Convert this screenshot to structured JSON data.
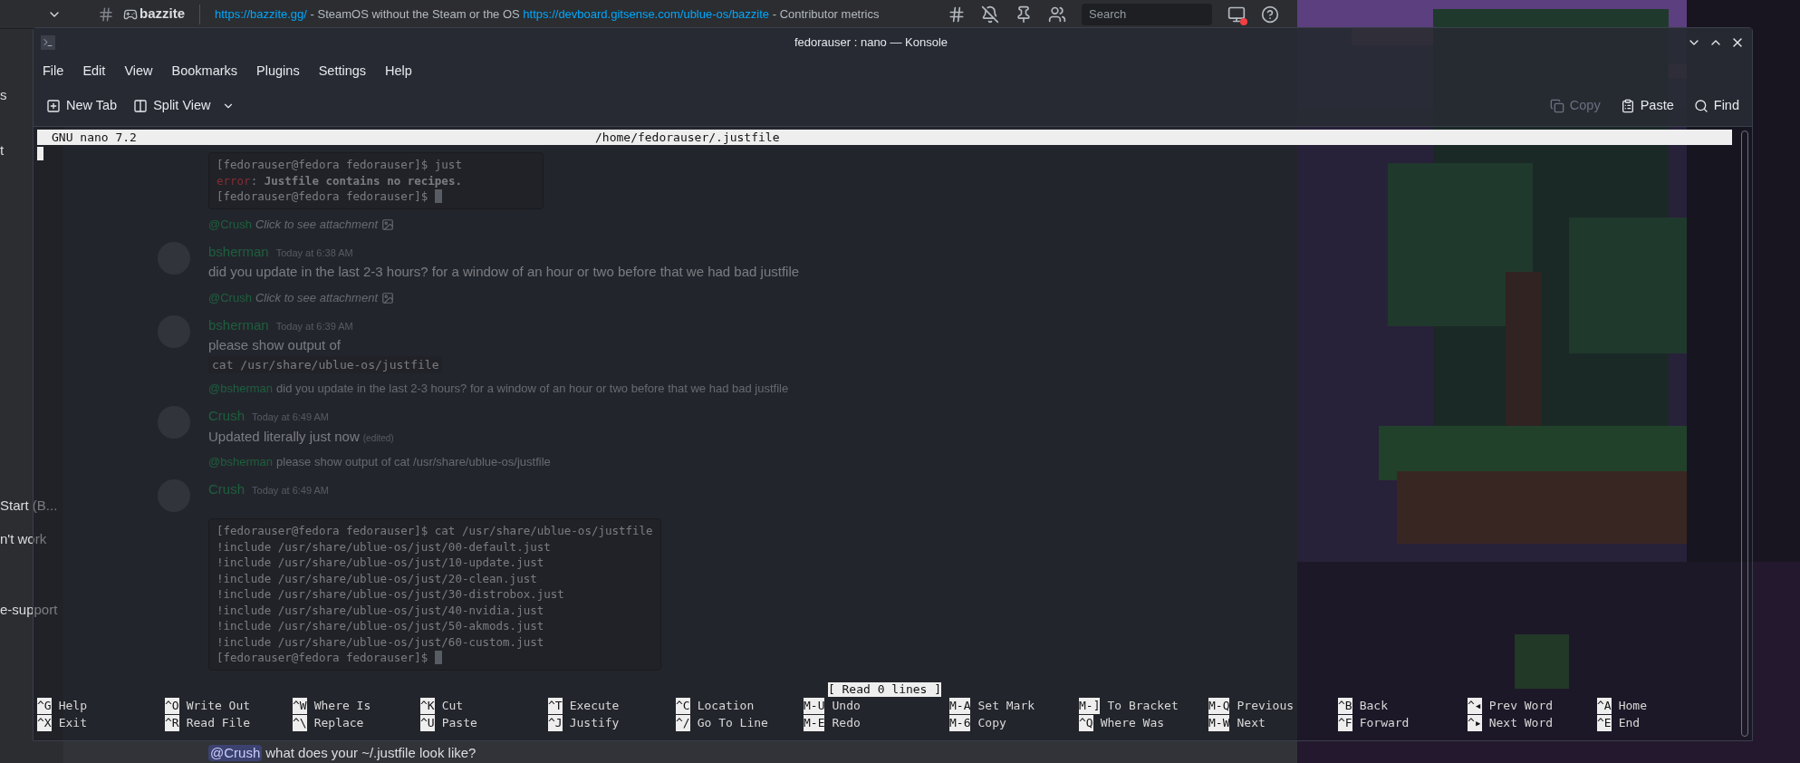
{
  "discord": {
    "channel": "bazzite",
    "topic": [
      {
        "kind": "link",
        "text": "https://bazzite.gg/"
      },
      {
        "kind": "text",
        "text": " - SteamOS without the Steam or the OS "
      },
      {
        "kind": "link",
        "text": "https://devboard.gitsense.com/ublue-os/bazzite"
      },
      {
        "kind": "text",
        "text": " - Contributor metrics"
      }
    ],
    "search": {
      "placeholder": "Search"
    },
    "sidebar_items": [
      {
        "label": "s"
      },
      {
        "label": "t"
      },
      {
        "label": "Start (B..."
      },
      {
        "label": "n't work"
      },
      {
        "label": "e-support"
      }
    ],
    "messages": [
      {
        "kind": "code",
        "lines": [
          {
            "kind": "plain",
            "text": "[fedorauser@fedora fedorauser]$ just"
          },
          {
            "kind": "error",
            "label": "error",
            "text": ": **Justfile contains no recipes.**"
          },
          {
            "kind": "prompt",
            "text": "[fedorauser@fedora fedorauser]$"
          }
        ]
      },
      {
        "kind": "reply",
        "mention": "@Crush",
        "text": "Click to see attachment",
        "attachment": true
      },
      {
        "kind": "message",
        "author": "bsherman",
        "time": "Today at 6:38 AM",
        "text": "did you update in the last 2-3 hours? for a window of an hour or two before that we had bad justfile"
      },
      {
        "kind": "reply",
        "mention": "@Crush",
        "text": "Click to see attachment",
        "attachment": true
      },
      {
        "kind": "message",
        "author": "bsherman",
        "time": "Today at 6:39 AM",
        "text": "please show output of",
        "code": "cat /usr/share/ublue-os/justfile"
      },
      {
        "kind": "reply",
        "mention": "@bsherman",
        "text": "did you update in the last 2-3 hours? for a window of an hour or two before that we had bad justfile",
        "attachment": false
      },
      {
        "kind": "message",
        "author": "Crush",
        "time": "Today at 6:49 AM",
        "text": "Updated literally just now",
        "edited": "(edited)"
      },
      {
        "kind": "reply",
        "mention": "@bsherman",
        "text": "please show output of cat /usr/share/ublue-os/justfile",
        "attachment": false
      },
      {
        "kind": "message",
        "author": "Crush",
        "time": "Today at 6:49 AM"
      },
      {
        "kind": "code",
        "lines": [
          {
            "kind": "plain",
            "text": "[fedorauser@fedora fedorauser]$ cat /usr/share/ublue-os/justfile"
          },
          {
            "kind": "plain",
            "text": "!include /usr/share/ublue-os/just/00-default.just"
          },
          {
            "kind": "plain",
            "text": "!include /usr/share/ublue-os/just/10-update.just"
          },
          {
            "kind": "plain",
            "text": "!include /usr/share/ublue-os/just/20-clean.just"
          },
          {
            "kind": "plain",
            "text": "!include /usr/share/ublue-os/just/30-distrobox.just"
          },
          {
            "kind": "plain",
            "text": "!include /usr/share/ublue-os/just/40-nvidia.just"
          },
          {
            "kind": "plain",
            "text": "!include /usr/share/ublue-os/just/50-akmods.just"
          },
          {
            "kind": "plain",
            "text": "!include /usr/share/ublue-os/just/60-custom.just"
          },
          {
            "kind": "prompt",
            "text": "[fedorauser@fedora fedorauser]$"
          }
        ]
      },
      {
        "kind": "mention_line",
        "mention": "@Crush",
        "text": "what does your ~/.justfile look like?"
      }
    ]
  },
  "konsole": {
    "title": "fedorauser : nano — Konsole",
    "menu": [
      "File",
      "Edit",
      "View",
      "Bookmarks",
      "Plugins",
      "Settings",
      "Help"
    ],
    "toolbar_left": [
      {
        "kind": "new_tab",
        "label": "New Tab"
      },
      {
        "kind": "split_view",
        "label": "Split View"
      }
    ],
    "toolbar_right": [
      {
        "kind": "copy",
        "label": "Copy",
        "disabled": true
      },
      {
        "kind": "paste",
        "label": "Paste",
        "disabled": false
      },
      {
        "kind": "find",
        "label": "Find",
        "disabled": false
      }
    ],
    "nano": {
      "version": "GNU nano 7.2",
      "file": "/home/fedorauser/.justfile",
      "status": "[ Read 0 lines ]",
      "shortcuts": [
        [
          {
            "key": "^G",
            "label": "Help"
          },
          {
            "key": "^O",
            "label": "Write Out"
          },
          {
            "key": "^W",
            "label": "Where Is"
          },
          {
            "key": "^K",
            "label": "Cut"
          },
          {
            "key": "^T",
            "label": "Execute"
          },
          {
            "key": "^C",
            "label": "Location"
          },
          {
            "key": "M-U",
            "label": "Undo"
          },
          {
            "key": "M-A",
            "label": "Set Mark"
          },
          {
            "key": "M-]",
            "label": "To Bracket"
          },
          {
            "key": "M-Q",
            "label": "Previous"
          },
          {
            "key": "^B",
            "label": "Back"
          },
          {
            "key": "^◂",
            "label": "Prev Word"
          },
          {
            "key": "^A",
            "label": "Home"
          }
        ],
        [
          {
            "key": "^X",
            "label": "Exit"
          },
          {
            "key": "^R",
            "label": "Read File"
          },
          {
            "key": "^\\",
            "label": "Replace"
          },
          {
            "key": "^U",
            "label": "Paste"
          },
          {
            "key": "^J",
            "label": "Justify"
          },
          {
            "key": "^/",
            "label": "Go To Line"
          },
          {
            "key": "M-E",
            "label": "Redo"
          },
          {
            "key": "M-6",
            "label": "Copy"
          },
          {
            "key": "^Q",
            "label": "Where Was"
          },
          {
            "key": "M-W",
            "label": "Next"
          },
          {
            "key": "^F",
            "label": "Forward"
          },
          {
            "key": "^▸",
            "label": "Next Word"
          },
          {
            "key": "^E",
            "label": "End"
          }
        ]
      ]
    }
  }
}
